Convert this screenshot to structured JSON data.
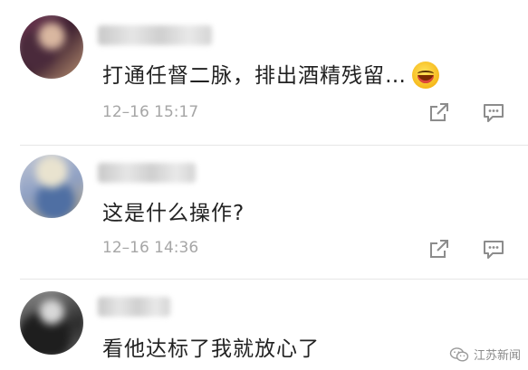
{
  "comments": [
    {
      "text": "打通任督二脉，排出酒精残留…",
      "emoji": "grinning-face-emoji",
      "time": "12–16 15:17",
      "icons": [
        "share-icon",
        "reply-comment-icon"
      ]
    },
    {
      "text": "这是什么操作?",
      "time": "12–16 14:36",
      "icons": [
        "share-icon",
        "reply-comment-icon"
      ]
    },
    {
      "text": "看他达标了我就放心了"
    }
  ],
  "watermark": {
    "label": "江苏新闻",
    "icon": "wechat-icon"
  },
  "colors": {
    "text": "#222222",
    "timestamp": "#a6a6a6",
    "icon": "#8c8c8c",
    "divider": "#e6e6e6",
    "background": "#ffffff"
  }
}
